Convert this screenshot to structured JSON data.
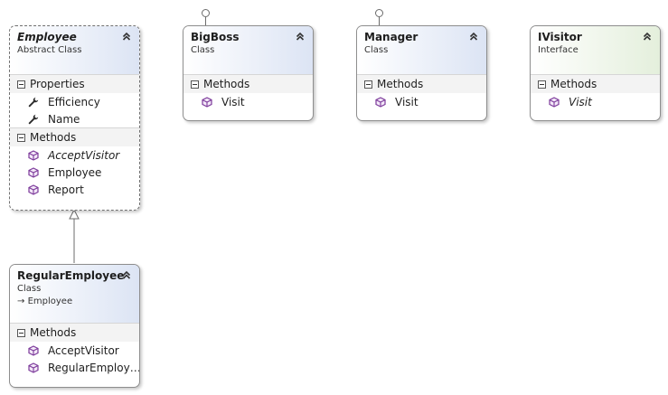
{
  "shapes": {
    "employee": {
      "name": "Employee",
      "stereotype": "Abstract Class",
      "properties_label": "Properties",
      "properties": [
        "Efficiency",
        "Name"
      ],
      "methods_label": "Methods",
      "methods": [
        "AcceptVisitor",
        "Employee",
        "Report"
      ]
    },
    "bigboss": {
      "name": "BigBoss",
      "stereotype": "Class",
      "methods_label": "Methods",
      "methods": [
        "Visit"
      ]
    },
    "manager": {
      "name": "Manager",
      "stereotype": "Class",
      "methods_label": "Methods",
      "methods": [
        "Visit"
      ]
    },
    "ivisitor": {
      "name": "IVisitor",
      "stereotype": "Interface",
      "methods_label": "Methods",
      "methods": [
        "Visit"
      ]
    },
    "regular": {
      "name": "RegularEmployee",
      "stereotype": "Class",
      "base": "Employee",
      "methods_label": "Methods",
      "methods": [
        "AcceptVisitor",
        "RegularEmploy…"
      ]
    }
  },
  "icons": {
    "collapse": "chevron-up-icon",
    "property": "wrench-icon",
    "method": "method-cube-icon",
    "inherit_arrow": "arrow-right-icon"
  },
  "colors": {
    "class_header": "#dce4f4",
    "interface_header": "#e4efdc",
    "method_icon": "#7d3b9b"
  }
}
